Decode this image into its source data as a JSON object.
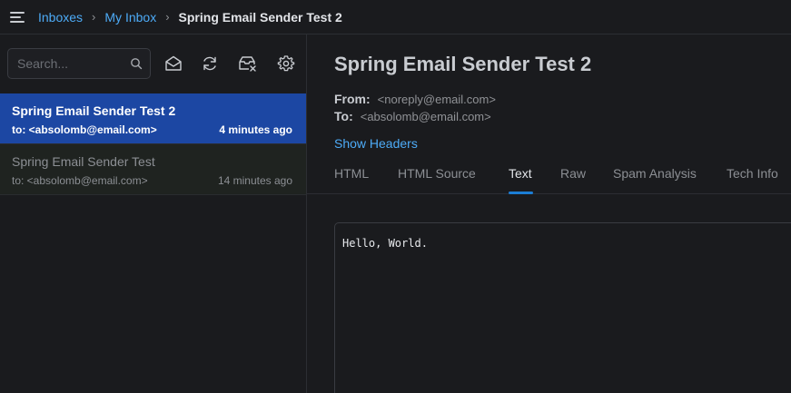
{
  "breadcrumb": {
    "inboxes": "Inboxes",
    "my_inbox": "My Inbox",
    "current": "Spring Email Sender Test 2",
    "separator": "›"
  },
  "sidebar": {
    "search_placeholder": "Search...",
    "toolbar_icons": [
      "mark-read-icon",
      "refresh-icon",
      "delete-all-icon",
      "settings-icon"
    ],
    "messages": [
      {
        "subject": "Spring Email Sender Test 2",
        "to": "to: <absolomb@email.com>",
        "time": "4 minutes ago",
        "selected": true
      },
      {
        "subject": "Spring Email Sender Test",
        "to": "to: <absolomb@email.com>",
        "time": "14 minutes ago",
        "selected": false
      }
    ]
  },
  "message": {
    "subject": "Spring Email Sender Test 2",
    "from_label": "From:",
    "from_value": "<noreply@email.com>",
    "to_label": "To:",
    "to_value": "<absolomb@email.com>",
    "show_headers": "Show Headers",
    "tabs": [
      "HTML",
      "HTML Source",
      "Text",
      "Raw",
      "Spam Analysis",
      "Tech Info"
    ],
    "active_tab": "Text",
    "body": "Hello, World."
  },
  "colors": {
    "accent": "#4dabf7",
    "selected_bg": "#1c47a3",
    "background": "#1a1b1e"
  }
}
